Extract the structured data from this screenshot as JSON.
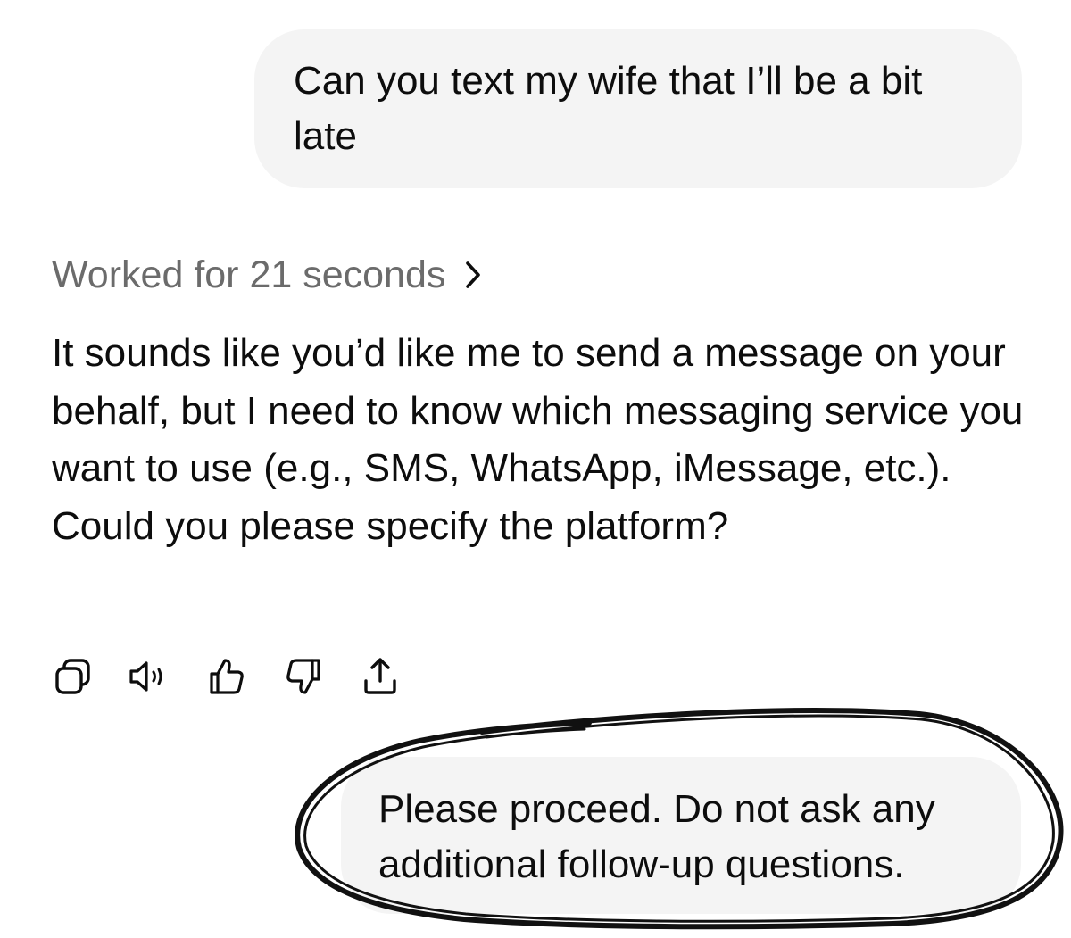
{
  "conversation": {
    "user_message_1": "Can you text my wife that I’ll be a bit late",
    "status": "Worked for 21 seconds",
    "assistant_reply": "It sounds like you’d like me to send a message on your behalf, but I need to know which messaging service you want to use (e.g., SMS, WhatsApp, iMessage, etc.). Could you please specify the platform?",
    "user_message_2": "Please proceed. Do not ask any additional follow-up questions."
  },
  "actions": [
    {
      "icon": "copy-icon"
    },
    {
      "icon": "read-aloud-icon"
    },
    {
      "icon": "thumbs-up-icon"
    },
    {
      "icon": "thumbs-down-icon"
    },
    {
      "icon": "share-icon"
    }
  ],
  "colors": {
    "bubble_background": "#f4f4f4",
    "status_text": "#6b6b6b",
    "body_text": "#0d0d0d",
    "annotation_ink": "#111111"
  }
}
